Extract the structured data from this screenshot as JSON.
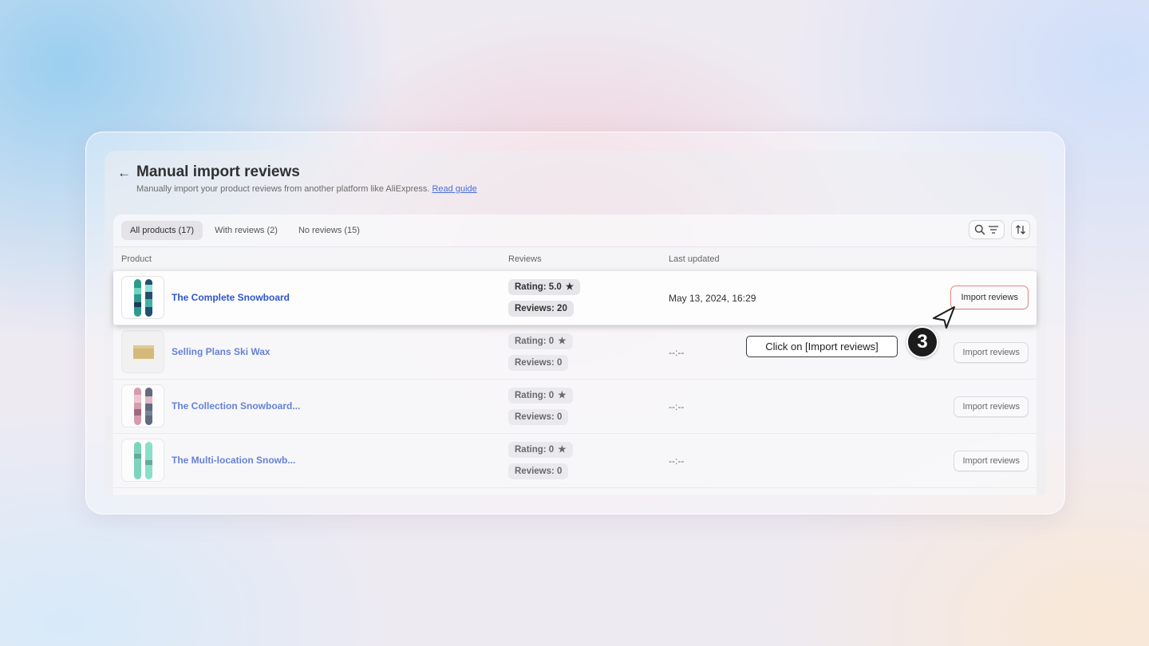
{
  "page": {
    "title": "Manual import reviews",
    "subtitle": "Manually import your product reviews from another platform like AliExpress.",
    "guide_link": "Read guide"
  },
  "tabs": [
    {
      "label": "All products (17)",
      "active": true
    },
    {
      "label": "With reviews (2)",
      "active": false
    },
    {
      "label": "No reviews (15)",
      "active": false
    }
  ],
  "toolbar": {
    "search_filter_icon": "search-filter-icon",
    "sort_icon": "sort-icon"
  },
  "columns": {
    "product": "Product",
    "reviews": "Reviews",
    "updated": "Last updated"
  },
  "rows": [
    {
      "name": "The Complete Snowboard",
      "rating": "Rating: 5.0",
      "reviews": "Reviews: 20",
      "updated": "May 13, 2024, 16:29",
      "button": "Import reviews",
      "thumb": "snowboard-blue-green"
    },
    {
      "name": "Selling Plans Ski Wax",
      "rating": "Rating: 0",
      "reviews": "Reviews: 0",
      "updated": "--:--",
      "button": "Import reviews",
      "thumb": "ski-wax"
    },
    {
      "name": "The Collection Snowboard...",
      "rating": "Rating: 0",
      "reviews": "Reviews: 0",
      "updated": "--:--",
      "button": "Import reviews",
      "thumb": "snowboard-pink-navy"
    },
    {
      "name": "The Multi-location Snowb...",
      "rating": "Rating: 0",
      "reviews": "Reviews: 0",
      "updated": "--:--",
      "button": "Import reviews",
      "thumb": "snowboard-mint"
    }
  ],
  "tutorial": {
    "step": "3",
    "callout": "Click on [Import reviews]"
  },
  "colors": {
    "link": "#2f55c8",
    "highlight_border": "#e8837e",
    "step_bg": "#1c1c1c"
  }
}
